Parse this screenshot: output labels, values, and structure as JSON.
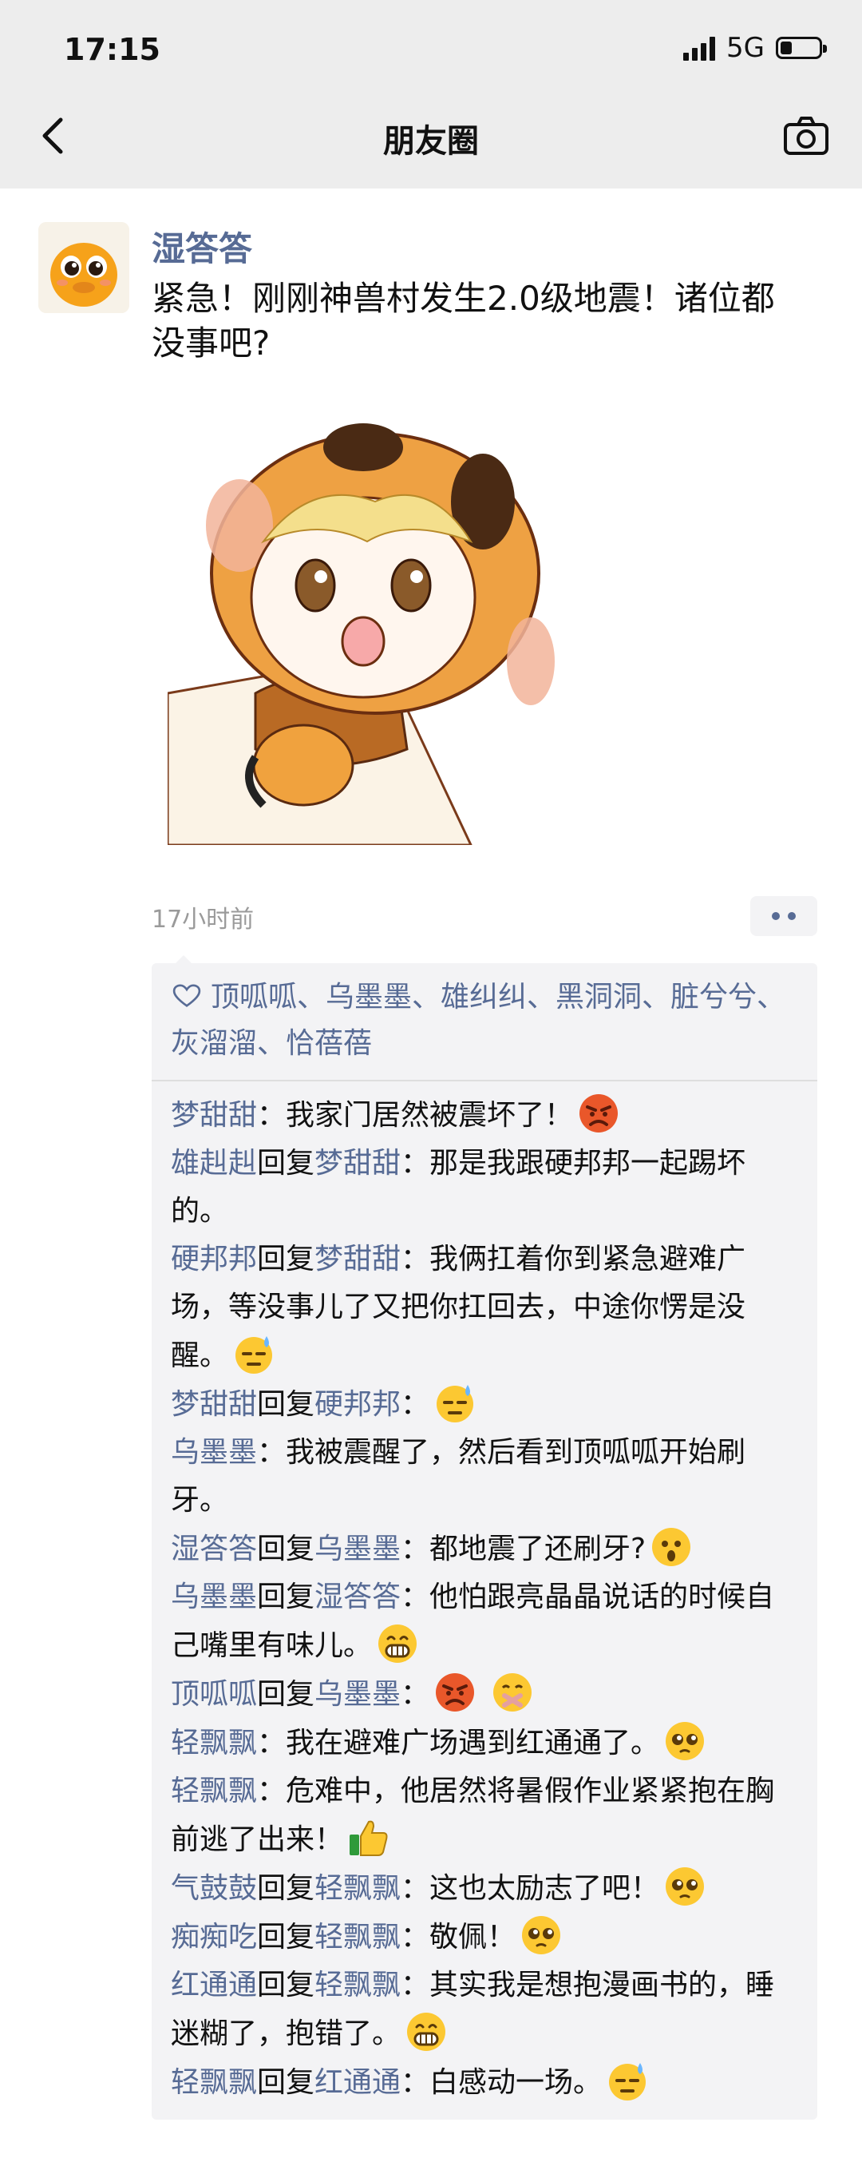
{
  "status_bar": {
    "time": "17:15",
    "network": "5G"
  },
  "nav": {
    "title": "朋友圈"
  },
  "post": {
    "author": "湿答答",
    "text": "紧急！刚刚神兽村发生2.0级地震！诸位都没事吧?",
    "time": "17小时前"
  },
  "likes": {
    "names": "顶呱呱、乌墨墨、雄纠纠、黑洞洞、脏兮兮、灰溜溜、恰蓓蓓"
  },
  "comments": [
    {
      "from": "梦甜甜",
      "reply_label": "",
      "to": "",
      "text": "：我家门居然被震坏了！",
      "emoji": "angry-face-icon"
    },
    {
      "from": "雄赳赳",
      "reply_label": "回复",
      "to": "梦甜甜",
      "text": "：那是我跟硬邦邦一起踢坏的。",
      "emoji": ""
    },
    {
      "from": "硬邦邦",
      "reply_label": "回复",
      "to": "梦甜甜",
      "text": "：我俩扛着你到紧急避难广场，等没事儿了又把你扛回去，中途你愣是没醒。",
      "emoji": "sweat-face-icon"
    },
    {
      "from": "梦甜甜",
      "reply_label": "回复",
      "to": "硬邦邦",
      "text": "：",
      "emoji": "sweat-face-icon"
    },
    {
      "from": "乌墨墨",
      "reply_label": "",
      "to": "",
      "text": "：我被震醒了，然后看到顶呱呱开始刷牙。",
      "emoji": ""
    },
    {
      "from": "湿答答",
      "reply_label": "回复",
      "to": "乌墨墨",
      "text": "：都地震了还刷牙?",
      "emoji": "surprised-face-icon"
    },
    {
      "from": "乌墨墨",
      "reply_label": "回复",
      "to": "湿答答",
      "text": "：他怕跟亮晶晶说话的时候自己嘴里有味儿。",
      "emoji": "grin-face-icon"
    },
    {
      "from": "顶呱呱",
      "reply_label": "回复",
      "to": "乌墨墨",
      "text": "：",
      "emoji": "angry-and-shush-icons"
    },
    {
      "from": "轻飘飘",
      "reply_label": "",
      "to": "",
      "text": "：我在避难广场遇到红通通了。",
      "emoji": "pleading-face-icon"
    },
    {
      "from": "轻飘飘",
      "reply_label": "",
      "to": "",
      "text": "：危难中，他居然将暑假作业紧紧抱在胸前逃了出来！",
      "emoji": "thumbs-up-icon"
    },
    {
      "from": "气鼓鼓",
      "reply_label": "回复",
      "to": "轻飘飘",
      "text": "：这也太励志了吧！",
      "emoji": "pleading-face-icon"
    },
    {
      "from": "痴痴吃",
      "reply_label": "回复",
      "to": "轻飘飘",
      "text": "：敬佩！",
      "emoji": "pleading-face-icon"
    },
    {
      "from": "红通通",
      "reply_label": "回复",
      "to": "轻飘飘",
      "text": "：其实我是想抱漫画书的，睡迷糊了，抱错了。",
      "emoji": "grin-face-icon"
    },
    {
      "from": "轻飘飘",
      "reply_label": "回复",
      "to": "红通通",
      "text": "：白感动一场。",
      "emoji": "sweat-face-icon"
    }
  ],
  "colors": {
    "name_blue": "#576b95",
    "bar_bg": "#ededed",
    "feed_bg": "#f3f3f5"
  }
}
